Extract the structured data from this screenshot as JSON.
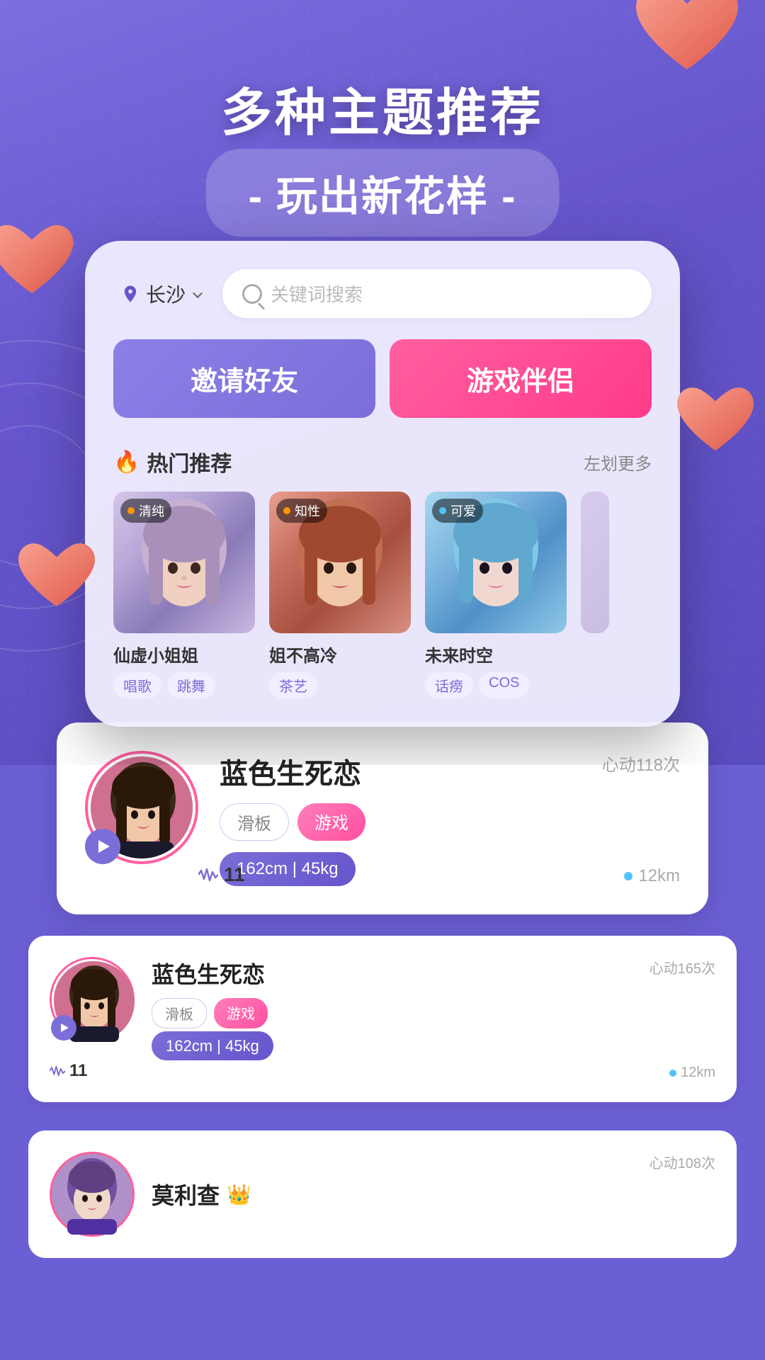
{
  "app": {
    "title": "多种主题推荐 玩出新花样"
  },
  "header": {
    "main_title": "多种主题推荐",
    "sub_title": "- 玩出新花样 -"
  },
  "search": {
    "location": "长沙",
    "placeholder": "关键词搜索"
  },
  "buttons": {
    "invite": "邀请好友",
    "game": "游戏伴侣"
  },
  "hot_section": {
    "title": "热门推荐",
    "more": "左划更多",
    "profiles": [
      {
        "tag": "清纯",
        "name": "仙虚小姐姐",
        "tags": [
          "唱歌",
          "跳舞"
        ],
        "tag_dot_color": "orange"
      },
      {
        "tag": "知性",
        "name": "姐不高冷",
        "tags": [
          "茶艺"
        ],
        "tag_dot_color": "orange"
      },
      {
        "tag": "可爱",
        "name": "未来时空",
        "tags": [
          "话痨",
          "COS"
        ],
        "tag_dot_color": "blue"
      }
    ]
  },
  "featured_user": {
    "name": "蓝色生死恋",
    "heart_count": "心动118次",
    "tags": [
      "滑板",
      "游戏"
    ],
    "height_weight": "162cm | 45kg",
    "waveform_count": "11",
    "distance": "12km"
  },
  "user_card_2": {
    "name": "蓝色生死恋",
    "heart_count": "心动165次",
    "tags": [
      "滑板",
      "游戏"
    ],
    "height_weight": "162cm | 45kg",
    "waveform_count": "11",
    "distance": "12km"
  },
  "user_card_3": {
    "name": "莫利查",
    "heart_count": "心动108次",
    "has_crown": true
  }
}
